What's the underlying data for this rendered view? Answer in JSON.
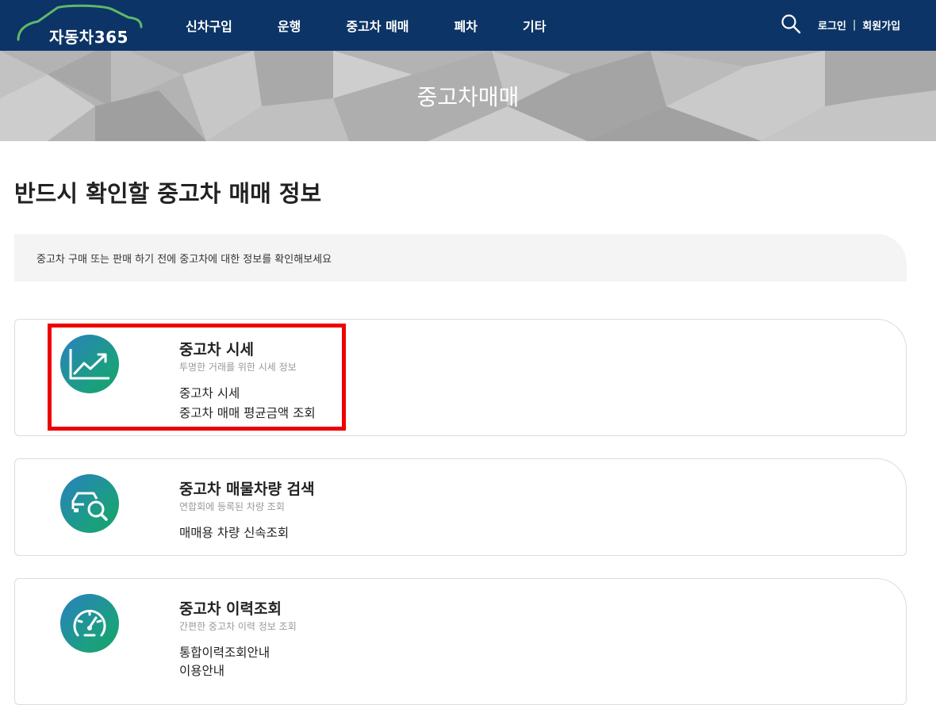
{
  "header": {
    "logo_text": "자동차365",
    "nav": [
      "신차구입",
      "운행",
      "중고차 매매",
      "폐차",
      "기타"
    ],
    "login": "로그인",
    "separator": "|",
    "signup": "회원가입"
  },
  "banner": {
    "title": "중고차매매"
  },
  "main": {
    "title": "반드시 확인할 중고차 매매 정보",
    "notice": "중고차 구매 또는 판매 하기 전에 중고차에 대한 정보를 확인해보세요"
  },
  "cards": [
    {
      "icon": "chart-up-icon",
      "title": "중고차 시세",
      "subtitle": "투명한 거래를 위한 시세 정보",
      "links": [
        "중고차 시세",
        "중고차 매매 평균금액 조회"
      ]
    },
    {
      "icon": "car-search-icon",
      "title": "중고차 매물차량 검색",
      "subtitle": "연합회에 등록된 차량 조회",
      "links": [
        "매매용 차량 신속조회"
      ]
    },
    {
      "icon": "speedometer-icon",
      "title": "중고차 이력조회",
      "subtitle": "간편한 중고차 이력 정보 조회",
      "links": [
        "통합이력조회안내",
        "이용안내"
      ]
    }
  ],
  "colors": {
    "header_bg": "#0c3466",
    "highlight": "#ee0000",
    "icon_gradient_start": "#2a80c0",
    "icon_gradient_end": "#16a06a"
  }
}
